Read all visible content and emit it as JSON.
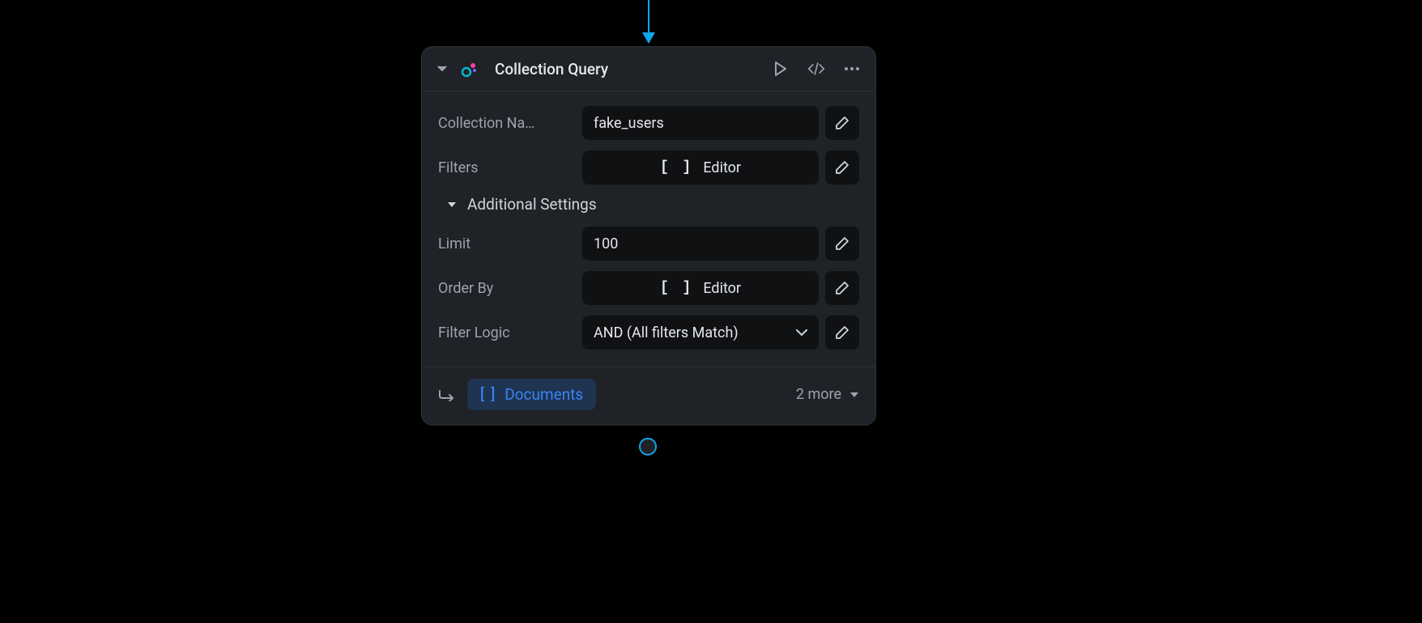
{
  "node": {
    "title": "Collection Query",
    "fields": {
      "collection_name": {
        "label": "Collection Na…",
        "value": "fake_users"
      },
      "filters": {
        "label": "Filters",
        "editor_prefix": "[ ]",
        "editor_label": "Editor"
      },
      "additional_settings_label": "Additional Settings",
      "limit": {
        "label": "Limit",
        "value": "100"
      },
      "order_by": {
        "label": "Order By",
        "editor_prefix": "[ ]",
        "editor_label": "Editor"
      },
      "filter_logic": {
        "label": "Filter Logic",
        "value": "AND (All filters Match)"
      }
    },
    "outputs": {
      "primary_prefix": "[ ]",
      "primary_label": "Documents",
      "more_label": "2 more"
    }
  }
}
